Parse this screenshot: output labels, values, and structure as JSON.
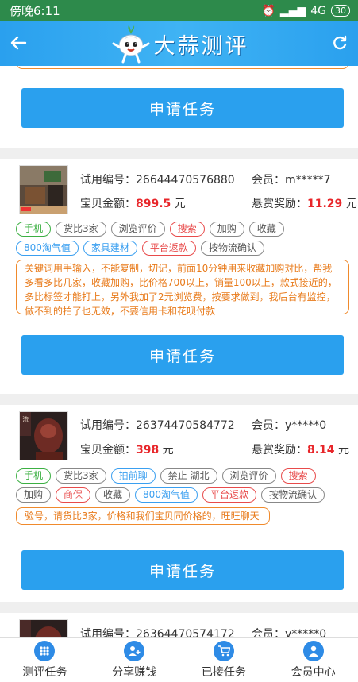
{
  "status": {
    "time": "傍晚6:11",
    "network": "4G",
    "battery": "30"
  },
  "header": {
    "title": "大蒜测评"
  },
  "apply_label": "申请任务",
  "tasks": [
    {
      "trial_label": "试用编号：26644470576880",
      "member_label": "会员：m*****7",
      "amount_prefix": "宝贝金额：",
      "amount": "899.5",
      "amount_unit": " 元",
      "reward_prefix": "悬赏奖励：",
      "reward": "11.29",
      "reward_unit": " 元",
      "tags": [
        {
          "text": "手机",
          "color": "green"
        },
        {
          "text": "货比3家",
          "color": "gray"
        },
        {
          "text": "浏览评价",
          "color": "gray"
        },
        {
          "text": "搜索",
          "color": "red"
        },
        {
          "text": "加购",
          "color": "gray"
        },
        {
          "text": "收藏",
          "color": "gray"
        },
        {
          "text": "800淘气值",
          "color": "blue"
        },
        {
          "text": "家具建材",
          "color": "blue"
        },
        {
          "text": "平台返款",
          "color": "red"
        },
        {
          "text": "按物流确认",
          "color": "gray"
        }
      ],
      "note": "关键词用手输入，不能复制，切记，前面10分钟用来收藏加购对比，帮我多看多比几家，收藏加购，比价格700以上，销量100以上，款式接近的，多比标签才能打上，另外我加了2元浏览费，按要求做到，我后台有监控，做不到的拍了也无效，不要信用卡和花呗付款"
    },
    {
      "trial_label": "试用编号：26374470584772",
      "member_label": "会员：y*****0",
      "amount_prefix": "宝贝金额：",
      "amount": "398",
      "amount_unit": " 元",
      "reward_prefix": "悬赏奖励：",
      "reward": "8.14",
      "reward_unit": " 元",
      "tags": [
        {
          "text": "手机",
          "color": "green"
        },
        {
          "text": "货比3家",
          "color": "gray"
        },
        {
          "text": "拍前聊",
          "color": "blue"
        },
        {
          "text": "禁止 湖北",
          "color": "gray"
        },
        {
          "text": "浏览评价",
          "color": "gray"
        },
        {
          "text": "搜索",
          "color": "red"
        },
        {
          "text": "加购",
          "color": "gray"
        },
        {
          "text": "商保",
          "color": "red"
        },
        {
          "text": "收藏",
          "color": "gray"
        },
        {
          "text": "800淘气值",
          "color": "blue"
        },
        {
          "text": "平台返款",
          "color": "red"
        },
        {
          "text": "按物流确认",
          "color": "gray"
        }
      ],
      "note": "验号，请货比3家，价格和我们宝贝同价格的，旺旺聊天"
    },
    {
      "trial_label": "试用编号：26364470574172",
      "member_label": "会员：y*****0"
    }
  ],
  "tabbar": [
    {
      "label": "测评任务",
      "icon": "grid-icon"
    },
    {
      "label": "分享赚钱",
      "icon": "add-person-icon"
    },
    {
      "label": "已接任务",
      "icon": "cart-icon"
    },
    {
      "label": "会员中心",
      "icon": "user-icon"
    }
  ],
  "colors": {
    "primary": "#2aa0ee",
    "status_bar": "#2d8a4b",
    "price_red": "#e8262a",
    "note_orange": "#f08a2c"
  }
}
